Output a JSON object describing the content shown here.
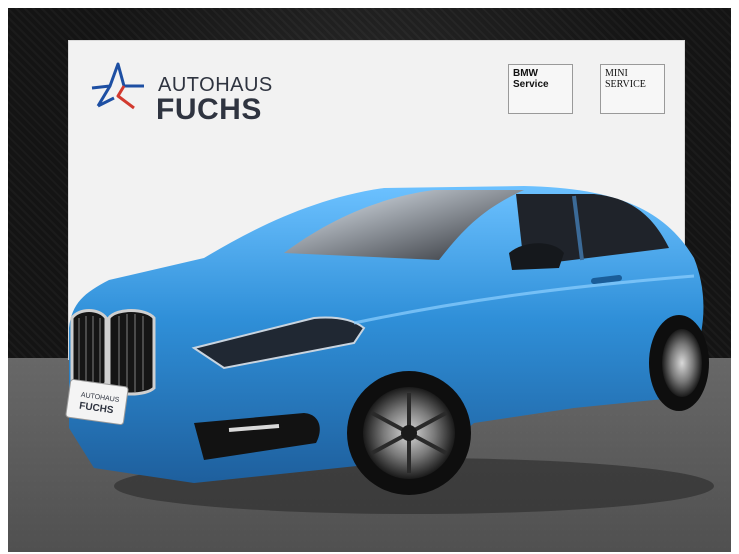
{
  "banner": {
    "brand_line1": "AUTOHAUS",
    "brand_line2": "FUCHS"
  },
  "signs": {
    "bmw": {
      "line1": "BMW",
      "line2": "Service"
    },
    "mini": {
      "line1": "MINI",
      "line2": "SERVICE"
    }
  },
  "plate": {
    "line1": "AUTOHAUS",
    "line2": "FUCHS"
  },
  "colors": {
    "car_blue": "#2f8fd8",
    "brand_blue": "#1d4fa3",
    "brand_red": "#d23a2f",
    "brand_text": "#2f3440"
  }
}
